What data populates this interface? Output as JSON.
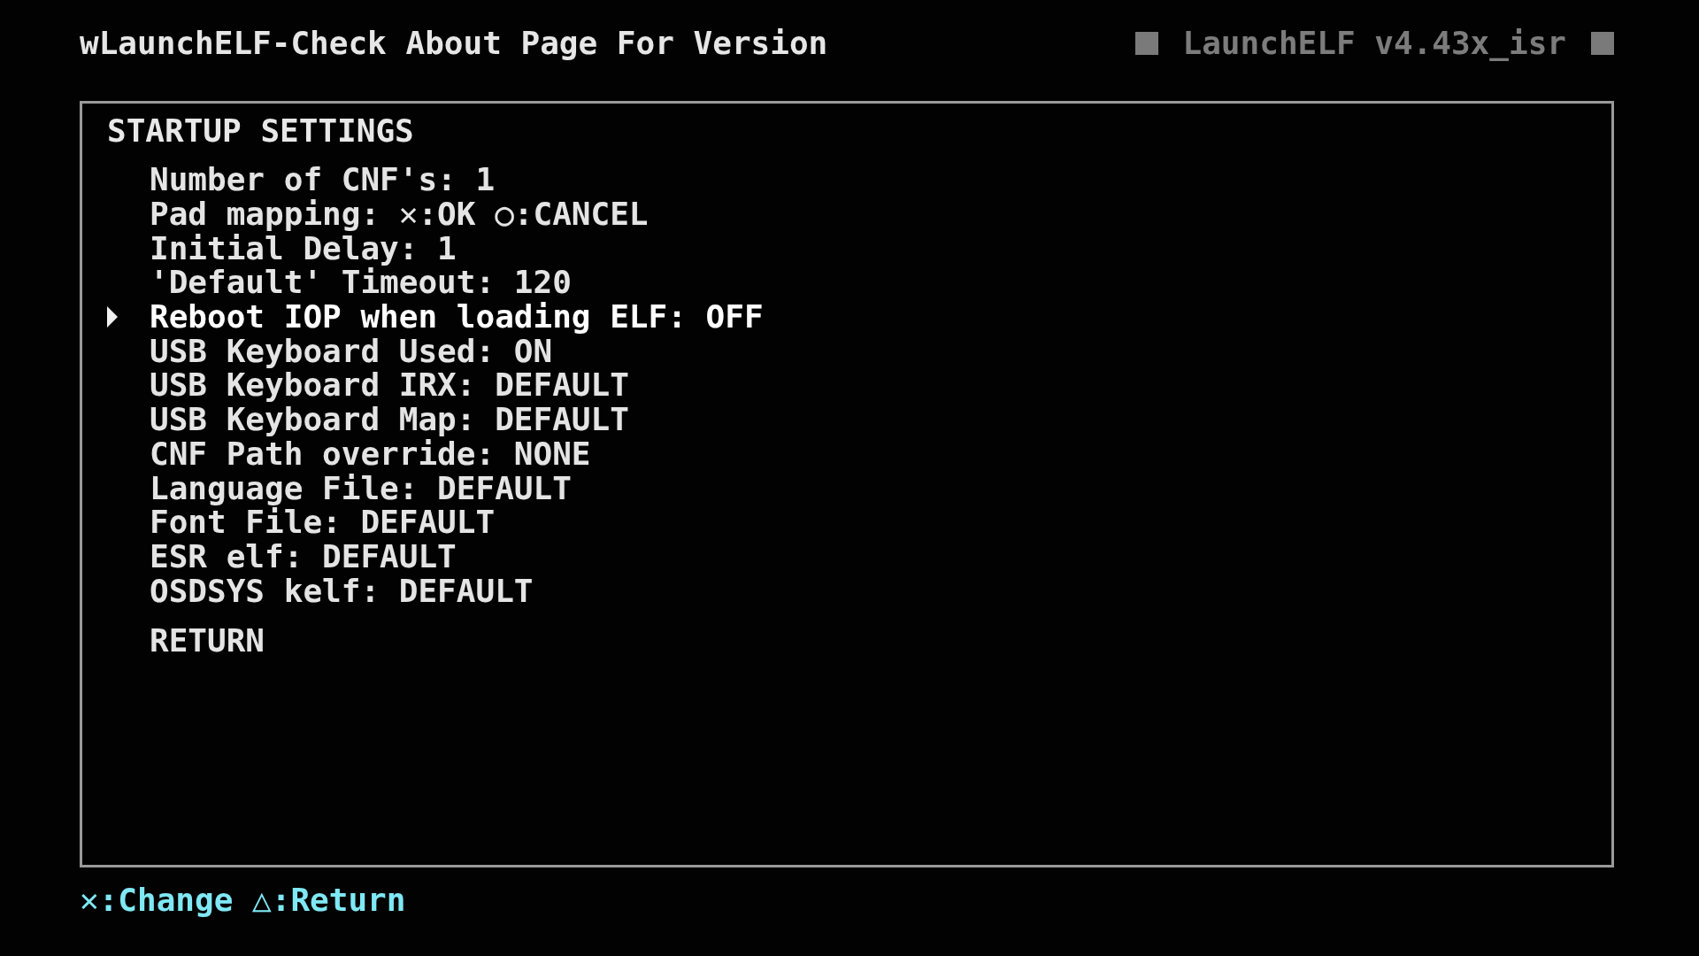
{
  "header": {
    "title": "wLaunchELF-Check About Page For Version",
    "version": "LaunchELF v4.43x_isr"
  },
  "panel": {
    "title": "STARTUP SETTINGS",
    "items": [
      {
        "label": "Number of CNF's: 1",
        "selected": false
      },
      {
        "label": "Pad mapping: ✕:OK ○:CANCEL",
        "selected": false
      },
      {
        "label": "Initial Delay: 1",
        "selected": false
      },
      {
        "label": "'Default' Timeout: 120",
        "selected": false
      },
      {
        "label": "Reboot IOP when loading ELF: OFF",
        "selected": true
      },
      {
        "label": "USB Keyboard Used: ON",
        "selected": false
      },
      {
        "label": "USB Keyboard IRX: DEFAULT",
        "selected": false
      },
      {
        "label": "USB Keyboard Map: DEFAULT",
        "selected": false
      },
      {
        "label": "CNF Path override: NONE",
        "selected": false
      },
      {
        "label": "Language File: DEFAULT",
        "selected": false
      },
      {
        "label": "Font File: DEFAULT",
        "selected": false
      },
      {
        "label": "ESR elf: DEFAULT",
        "selected": false
      },
      {
        "label": "OSDSYS kelf: DEFAULT",
        "selected": false
      }
    ],
    "return_item": {
      "label": "RETURN",
      "selected": false
    }
  },
  "footer": {
    "hint": "✕:Change △:Return"
  }
}
